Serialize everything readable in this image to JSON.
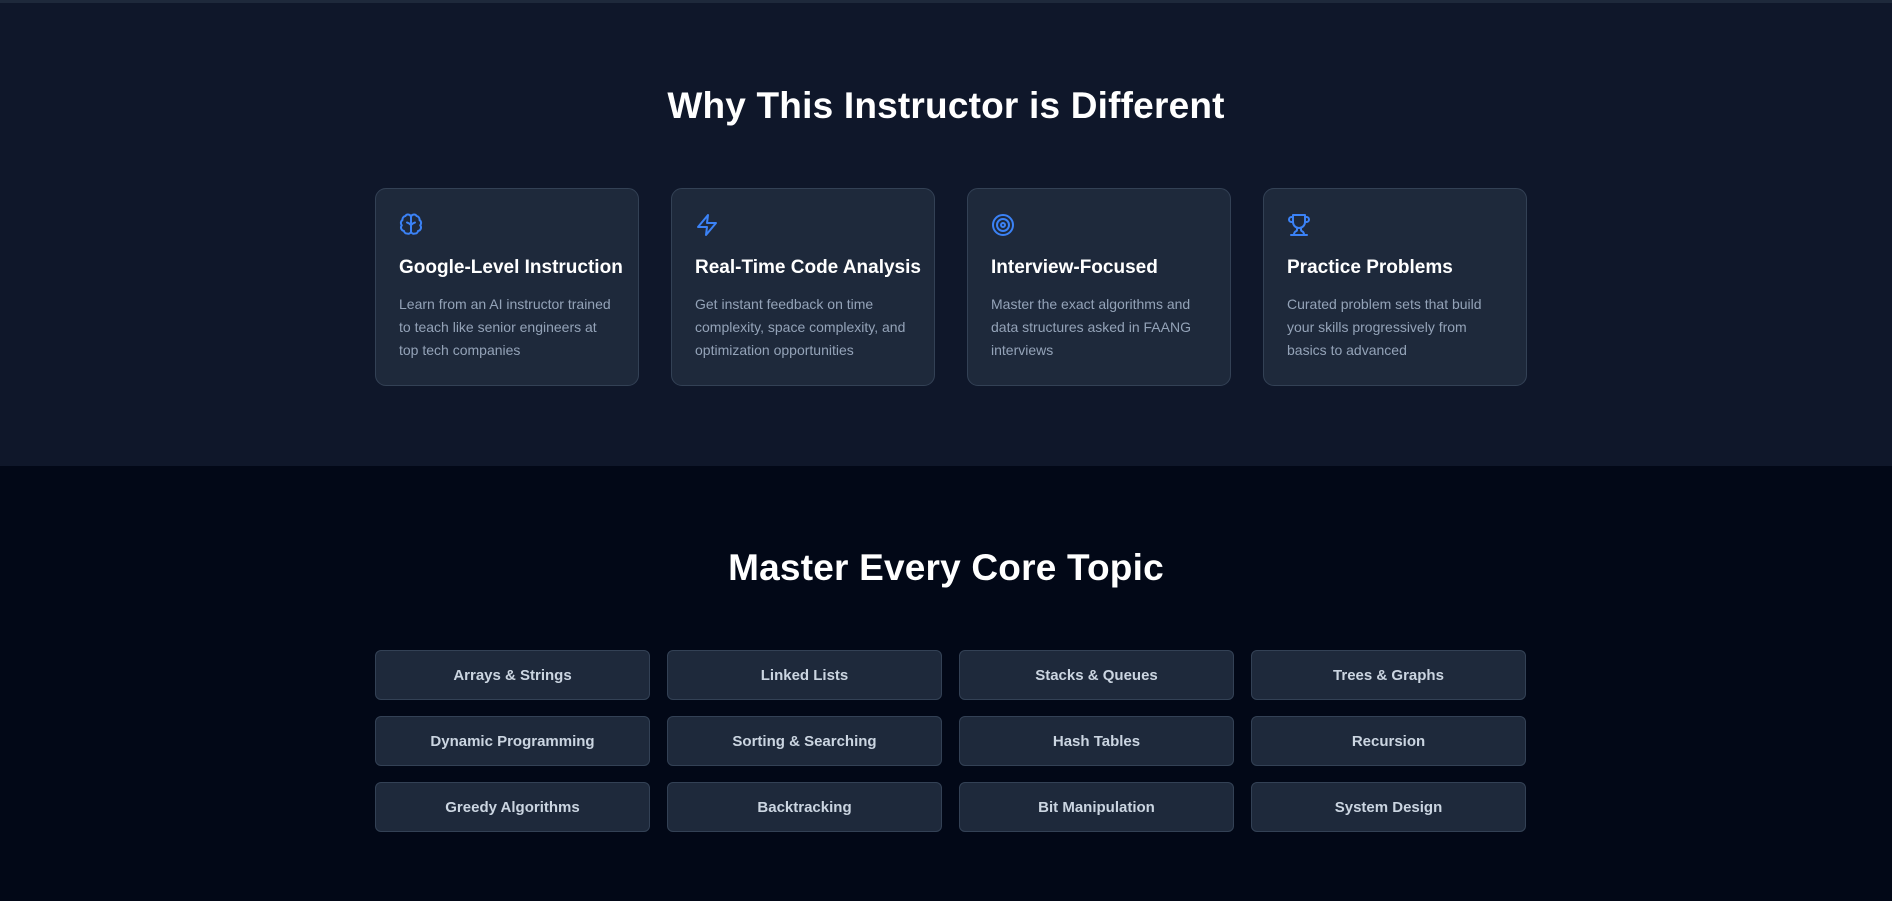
{
  "colors": {
    "features_bg": "#0f172a",
    "topics_bg": "#020817",
    "card_bg": "#1e293b",
    "card_border": "#334155",
    "accent": "#3b82f6",
    "muted_text": "#94a3b8",
    "chip_text": "#cbd5e1"
  },
  "features": {
    "title": "Why This Instructor is Different",
    "cards": [
      {
        "icon": "brain-icon",
        "title": "Google-Level Instruction",
        "description": "Learn from an AI instructor trained to teach like senior engineers at top tech companies"
      },
      {
        "icon": "lightning-icon",
        "title": "Real-Time Code Analysis",
        "description": "Get instant feedback on time complexity, space complexity, and optimization opportunities"
      },
      {
        "icon": "target-icon",
        "title": "Interview-Focused",
        "description": "Master the exact algorithms and data structures asked in FAANG interviews"
      },
      {
        "icon": "trophy-icon",
        "title": "Practice Problems",
        "description": "Curated problem sets that build your skills progressively from basics to advanced"
      }
    ]
  },
  "topics": {
    "title": "Master Every Core Topic",
    "items": [
      "Arrays & Strings",
      "Linked Lists",
      "Stacks & Queues",
      "Trees & Graphs",
      "Dynamic Programming",
      "Sorting & Searching",
      "Hash Tables",
      "Recursion",
      "Greedy Algorithms",
      "Backtracking",
      "Bit Manipulation",
      "System Design"
    ]
  }
}
